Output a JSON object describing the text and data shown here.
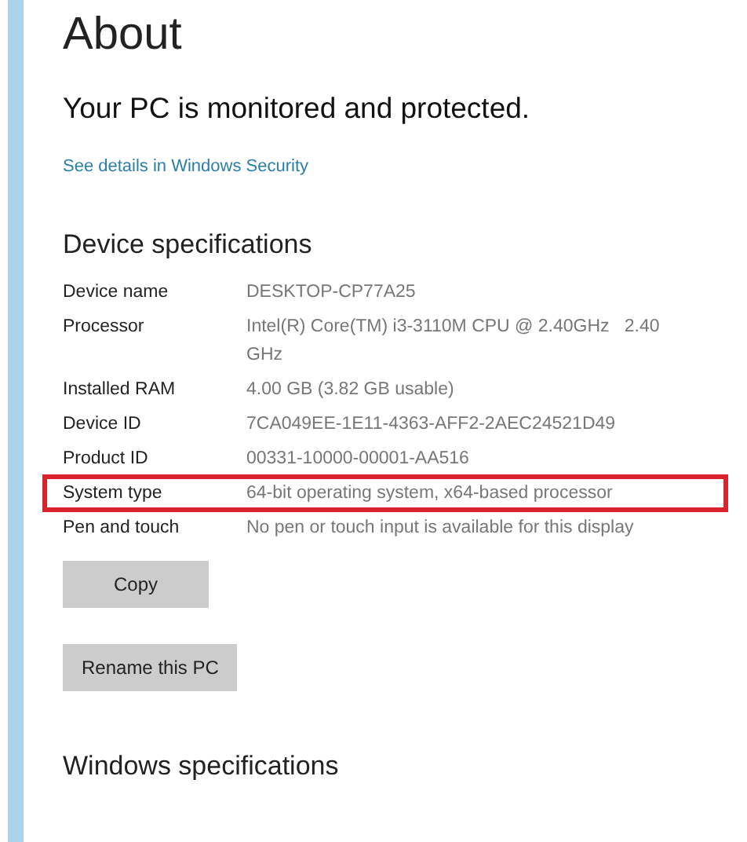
{
  "title": "About",
  "status": "Your PC is monitored and protected.",
  "security_link": "See details in Windows Security",
  "device_specifications": {
    "heading": "Device specifications",
    "rows": [
      {
        "label": "Device name",
        "value": "DESKTOP-CP77A25",
        "highlighted": false
      },
      {
        "label": "Processor",
        "value": "Intel(R) Core(TM) i3-3110M CPU @ 2.40GHz   2.40 GHz",
        "highlighted": false
      },
      {
        "label": "Installed RAM",
        "value": "4.00 GB (3.82 GB usable)",
        "highlighted": false
      },
      {
        "label": "Device ID",
        "value": "7CA049EE-1E11-4363-AFF2-2AEC24521D49",
        "highlighted": false
      },
      {
        "label": "Product ID",
        "value": "00331-10000-00001-AA516",
        "highlighted": false
      },
      {
        "label": "System type",
        "value": "64-bit operating system, x64-based processor",
        "highlighted": true
      },
      {
        "label": "Pen and touch",
        "value": "No pen or touch input is available for this display",
        "highlighted": false
      }
    ],
    "buttons": [
      "Copy",
      "Rename this PC"
    ]
  },
  "windows_specifications": {
    "heading": "Windows specifications"
  }
}
